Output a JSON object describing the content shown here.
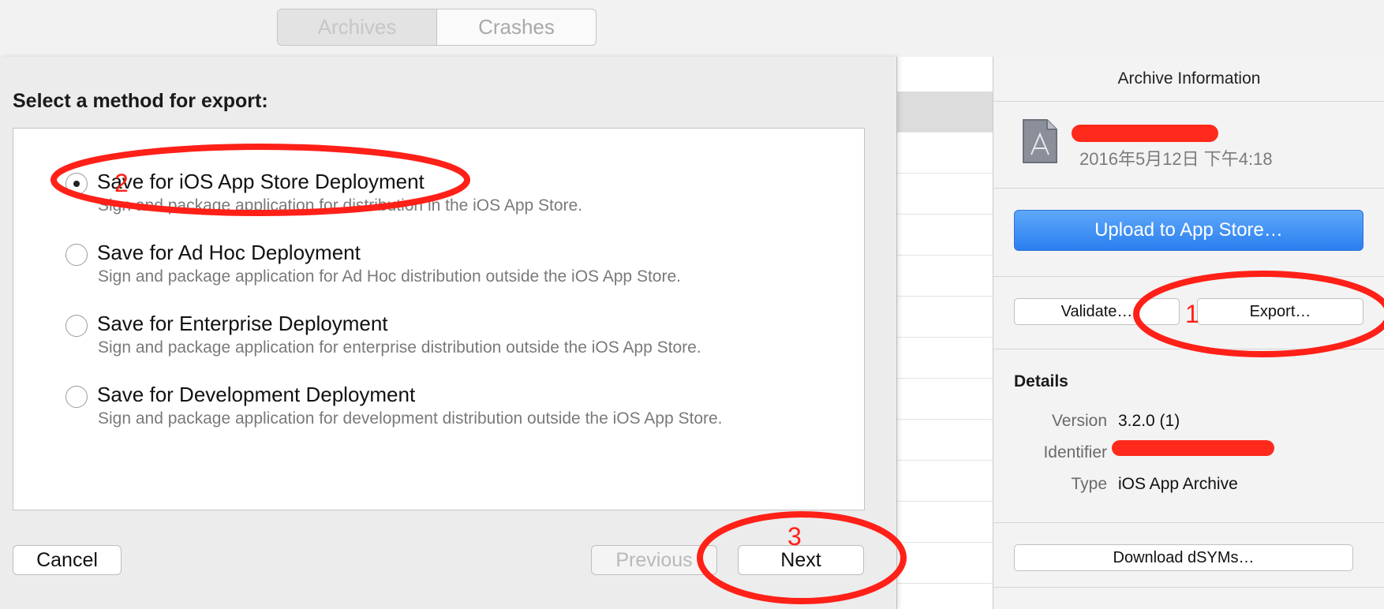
{
  "toolbar": {
    "tabs": [
      {
        "label": "Archives"
      },
      {
        "label": "Crashes"
      }
    ]
  },
  "sheet": {
    "title": "Select a method for export:",
    "options": [
      {
        "title": "Save for iOS App Store Deployment",
        "description": "Sign and package application for distribution in the iOS App Store.",
        "selected": true
      },
      {
        "title": "Save for Ad Hoc Deployment",
        "description": "Sign and package application for Ad Hoc distribution outside the iOS App Store.",
        "selected": false
      },
      {
        "title": "Save for Enterprise Deployment",
        "description": "Sign and package application for enterprise distribution outside the iOS App Store.",
        "selected": false
      },
      {
        "title": "Save for Development Deployment",
        "description": "Sign and package application for development distribution outside the iOS App Store.",
        "selected": false
      }
    ],
    "buttons": {
      "cancel": "Cancel",
      "previous": "Previous",
      "next": "Next"
    }
  },
  "inspector": {
    "header": "Archive Information",
    "archive": {
      "date": "2016年5月12日 下午4:18",
      "icon": "app-archive-icon"
    },
    "upload_button": "Upload to App Store…",
    "validate_button": "Validate…",
    "export_button": "Export…",
    "details": {
      "title": "Details",
      "version_label": "Version",
      "version_value": "3.2.0 (1)",
      "identifier_label": "Identifier",
      "type_label": "Type",
      "type_value": "iOS App Archive"
    },
    "download_dsyms_button": "Download dSYMs…"
  },
  "annotations": {
    "step1": "1",
    "step2": "2",
    "step3": "3",
    "color": "#ff2018"
  },
  "colors": {
    "accent_blue": "#2a7ff0",
    "redaction": "#ff2a1c"
  }
}
